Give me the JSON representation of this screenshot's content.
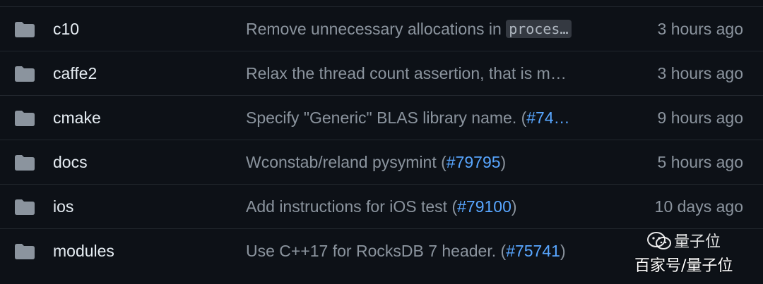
{
  "colors": {
    "background": "#0d1117",
    "divider": "#21262d",
    "folder_icon": "#8b949e",
    "name_text": "#e6edf3",
    "message_text": "#8b949e",
    "link": "#58a6ff",
    "code_bg": "#343941"
  },
  "rows": [
    {
      "icon": "folder-icon",
      "name": "c10",
      "message_text": "Remove unnecessary allocations in ",
      "message_code": "proces…",
      "message_link": "",
      "message_suffix": "",
      "time": "3 hours ago"
    },
    {
      "icon": "folder-icon",
      "name": "caffe2",
      "message_text": "Relax the thread count assertion, that is m…",
      "message_code": "",
      "message_link": "",
      "message_suffix": "",
      "time": "3 hours ago"
    },
    {
      "icon": "folder-icon",
      "name": "cmake",
      "message_text": "Specify \"Generic\" BLAS library name. (",
      "message_code": "",
      "message_link": "#74…",
      "message_suffix": "",
      "time": "9 hours ago"
    },
    {
      "icon": "folder-icon",
      "name": "docs",
      "message_text": "Wconstab/reland pysymint (",
      "message_code": "",
      "message_link": "#79795",
      "message_suffix": ")",
      "time": "5 hours ago"
    },
    {
      "icon": "folder-icon",
      "name": "ios",
      "message_text": "Add instructions for iOS test (",
      "message_code": "",
      "message_link": "#79100",
      "message_suffix": ")",
      "time": "10 days ago"
    },
    {
      "icon": "folder-icon",
      "name": "modules",
      "message_text": "Use C++17 for RocksDB 7 header. (",
      "message_code": "",
      "message_link": "#75741",
      "message_suffix": ")",
      "time": ""
    }
  ],
  "watermark": {
    "top": "量子位",
    "bottom": "百家号/量子位"
  }
}
